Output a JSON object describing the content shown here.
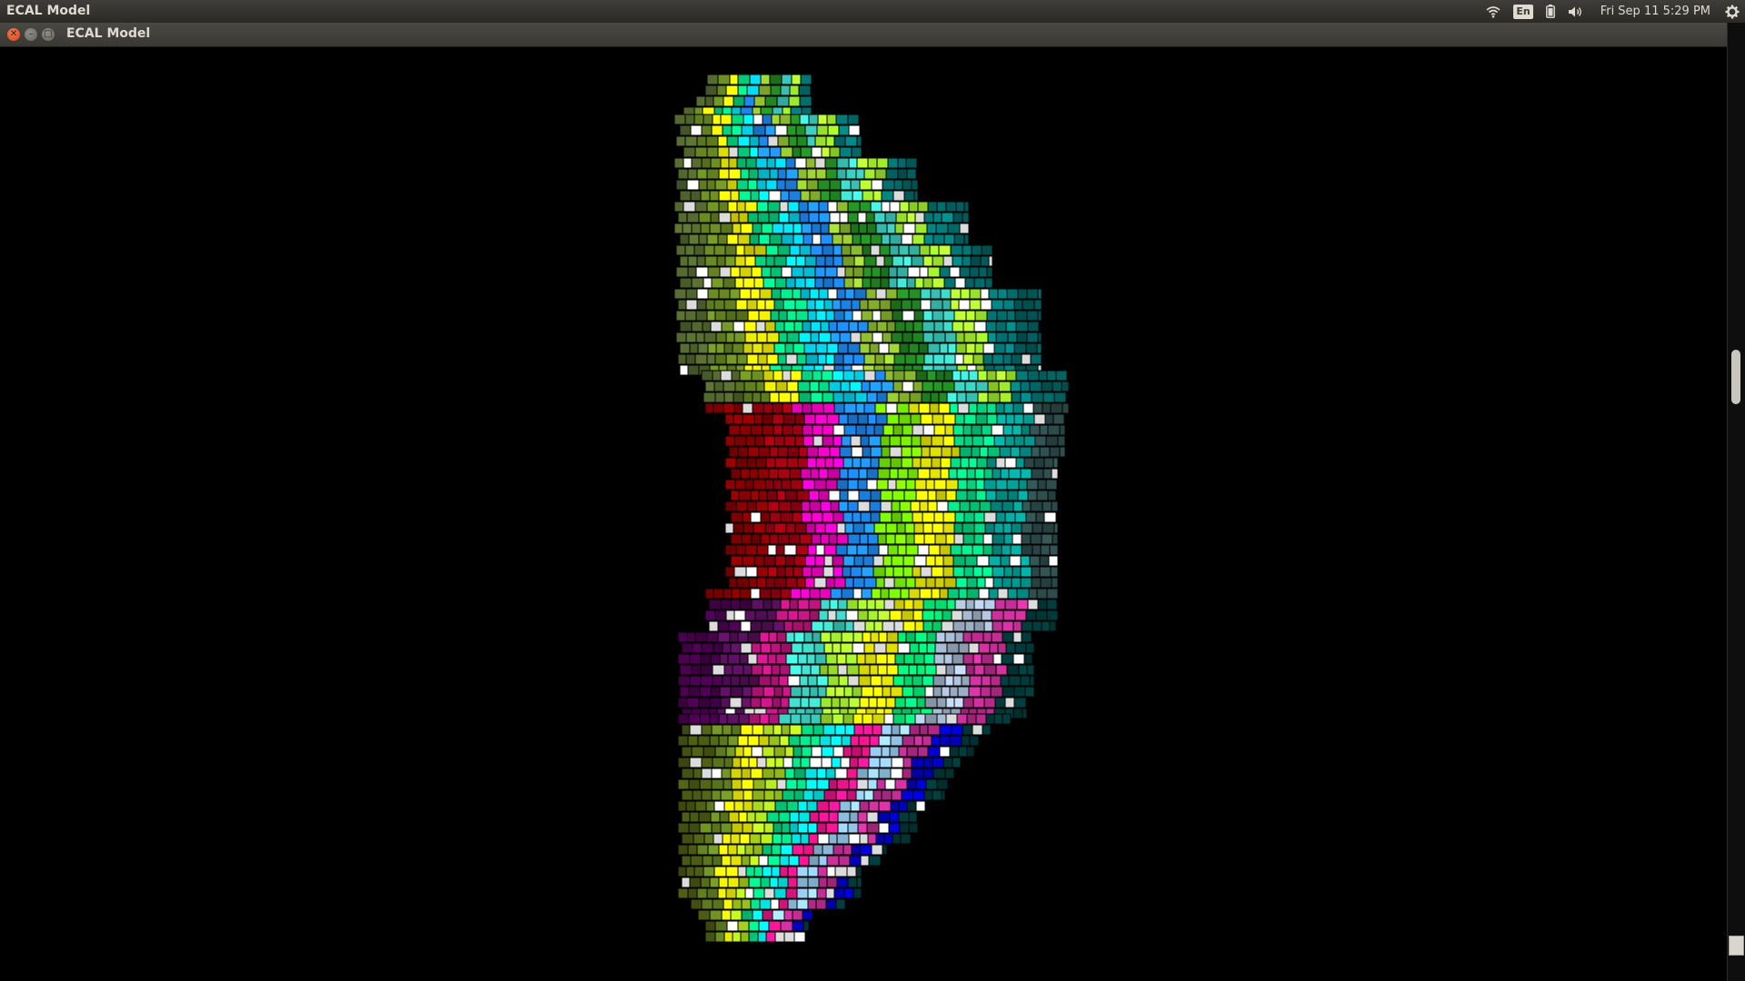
{
  "topbar": {
    "app_title": "ECAL Model",
    "language": "En",
    "clock": "Fri Sep 11  5:29 PM",
    "icons": [
      "wifi-icon",
      "keyboard-language-icon",
      "battery-icon",
      "volume-icon",
      "settings-gear-icon"
    ]
  },
  "window": {
    "title": "ECAL Model",
    "controls": [
      "close",
      "minimize",
      "maximize"
    ]
  },
  "visualization": {
    "description_colors": {
      "background": "#000000",
      "cell_border": "#000000"
    },
    "palette": [
      "#ff00cc",
      "#ff1493",
      "#ff1f8f",
      "#e0208a",
      "#c71585",
      "#cc2f9c",
      "#0a86ff",
      "#1e90ff",
      "#0f7fe6",
      "#3aa0ff",
      "#7fff00",
      "#9acd32",
      "#adff2f",
      "#b5e61d",
      "#ffff00",
      "#fff200",
      "#f5e800",
      "#ffe600",
      "#00e68a",
      "#1aff9c",
      "#00ff7f",
      "#33e0a0",
      "#00e5ff",
      "#00ffff",
      "#40e0d0",
      "#6ff",
      "#800000",
      "#8b0000",
      "#a00010",
      "#ff0000",
      "#556b2f",
      "#6b8e23",
      "#4b5a12",
      "#808000",
      "#2f4f4f",
      "#006060",
      "#008080",
      "#00a39a",
      "#8fbcd4",
      "#9ad0f5",
      "#b0c4de",
      "#dcdcdc",
      "#4b0050",
      "#5b1060",
      "#7a2f70",
      "#8b4513",
      "#e9967a",
      "#fa8072",
      "#ff8080",
      "#228b22",
      "#0000cd",
      "#1e3fff",
      "#191970",
      "#4169e1",
      "#ffffff",
      "#c0c0c0",
      "#808080",
      "#003a3a"
    ]
  }
}
